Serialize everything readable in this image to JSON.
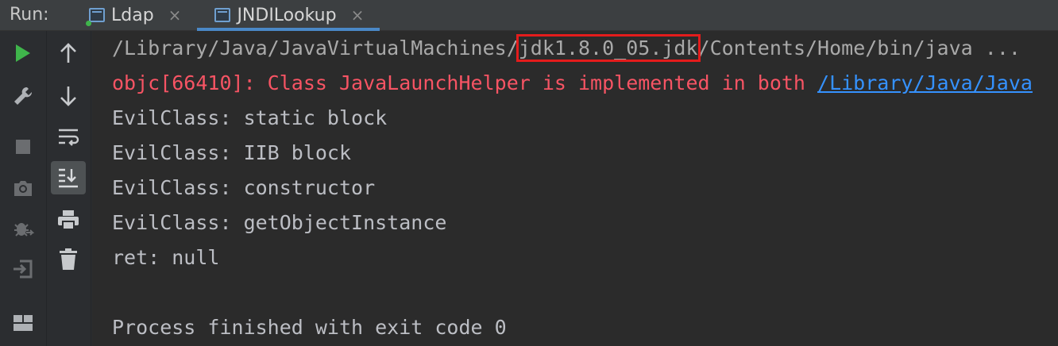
{
  "tabbar": {
    "run_label": "Run:",
    "tabs": [
      {
        "label": "Ldap",
        "close": "×",
        "active": false
      },
      {
        "label": "JNDILookup",
        "close": "×",
        "active": true
      }
    ]
  },
  "toolbar_left": [
    "run-icon",
    "wrench-icon",
    "stop-icon",
    "camera-icon",
    "debug-icon",
    "login-icon",
    "layout-icon"
  ],
  "toolbar_right": [
    "arrow-up-icon",
    "arrow-down-icon",
    "soft-wrap-icon",
    "scroll-to-end-icon",
    "print-icon",
    "trash-icon"
  ],
  "console": {
    "cmd_prefix": "/Library/Java/JavaVirtualMachines/",
    "cmd_highlight": "jdk1.8.0_05.jdk",
    "cmd_suffix": "/Contents/Home/bin/java ...",
    "err_text": "objc[66410]: Class JavaLaunchHelper is implemented in both ",
    "err_link": "/Library/Java/Java",
    "lines": [
      "EvilClass: static block",
      "EvilClass: IIB block",
      "EvilClass: constructor",
      "EvilClass: getObjectInstance",
      "ret: null",
      "",
      "Process finished with exit code 0"
    ]
  },
  "colors": {
    "highlight_box": "#e41c1c",
    "error_text": "#f75464",
    "link": "#3592ff",
    "run_green": "#3fb54b"
  }
}
